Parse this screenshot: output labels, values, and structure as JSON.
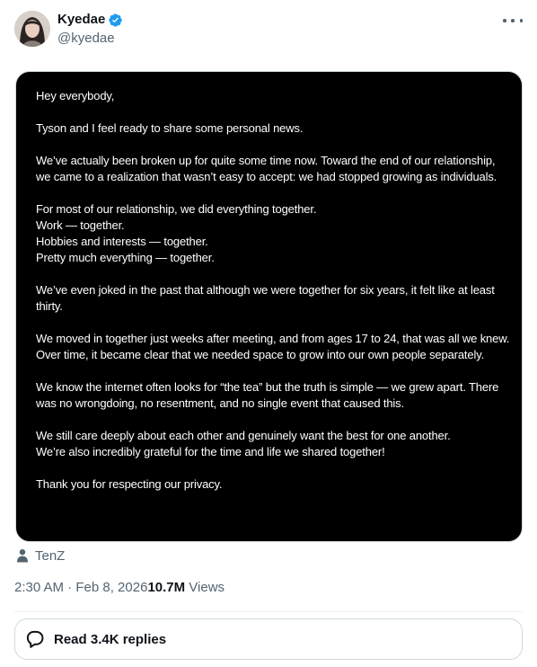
{
  "author": {
    "display_name": "Kyedae",
    "handle": "@kyedae",
    "verified": true,
    "verified_color": "#1d9bf0"
  },
  "post": {
    "letter": {
      "paragraphs": [
        [
          "Hey everybody,"
        ],
        [
          "Tyson and I feel ready to share some personal news."
        ],
        [
          "We’ve actually been broken up for quite some time now. Toward the end of our relationship, we came to a realization that wasn’t easy to accept: we had stopped growing as individuals."
        ],
        [
          "For most of our relationship, we did everything together.",
          "Work — together.",
          "Hobbies and interests — together.",
          "Pretty much everything — together."
        ],
        [
          "We’ve even joked in the past that although we were together for six years, it felt like at least thirty."
        ],
        [
          "We moved in together just weeks after meeting, and from ages 17 to 24, that was all we knew. Over time, it became clear that we needed space to grow into our own people separately."
        ],
        [
          "We know the internet often looks for “the tea” but the truth is simple — we grew apart. There was no wrongdoing, no resentment, and no single event that caused this."
        ],
        [
          "We still care deeply about each other and genuinely want the best for one another.",
          "We’re also incredibly grateful for the time and life we shared together!"
        ],
        [
          "Thank you for respecting our privacy."
        ]
      ]
    },
    "tagged_user": "TenZ",
    "timestamp": "2:30 AM · Feb 8, 2026",
    "views_count": "10.7M",
    "views_label": " Views"
  },
  "replies_button": {
    "label": "Read 3.4K replies"
  },
  "icons": {
    "verified": "verified-badge-icon",
    "more": "more-horizontal-icon",
    "tag": "person-icon",
    "replies": "chat-bubble-icon"
  }
}
